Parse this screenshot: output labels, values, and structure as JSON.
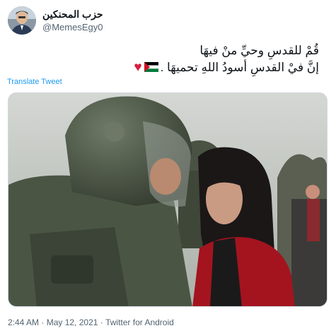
{
  "author": {
    "display_name": "حزب المحنكين",
    "handle": "@MemesEgy0"
  },
  "tweet": {
    "line1": "قُمْ للقدسِ وحيِّ منْ فيهَا",
    "line2_text": "إنَّ فيْ القدسِ أسودُ اللهِ تحميهَا .",
    "flag_icon": "palestine-flag-icon",
    "heart_icon": "red-heart-icon",
    "heart_glyph": "♥",
    "translate_label": "Translate Tweet"
  },
  "meta": {
    "time": "2:44 AM",
    "separator1": " · ",
    "date": "May 12, 2021",
    "separator2": " · ",
    "source": "Twitter for Android"
  },
  "colors": {
    "link": "#1d9bf0",
    "secondary_text": "#536471",
    "heart": "#d81b3c",
    "flag_green": "#007a3d",
    "flag_red": "#ce1126"
  }
}
